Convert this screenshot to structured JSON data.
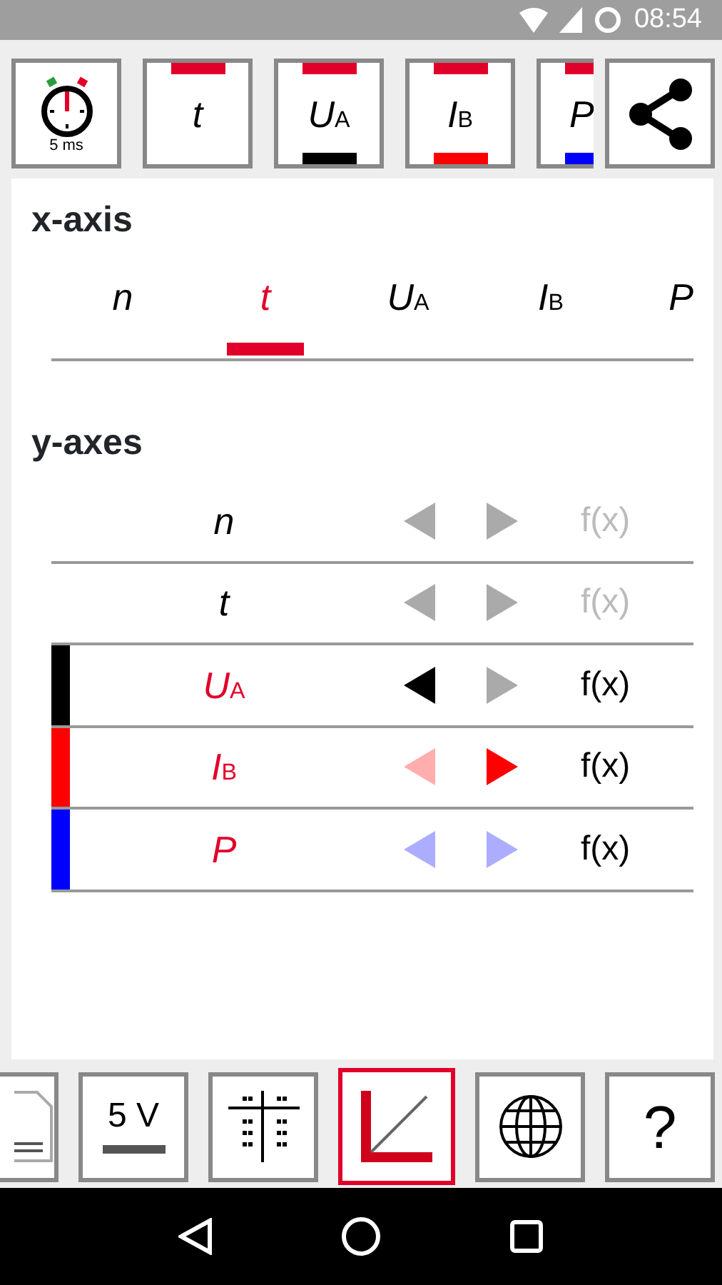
{
  "status_bar": {
    "time": "08:54"
  },
  "top_toolbar": {
    "timer": {
      "label": "5 ms"
    },
    "channels": [
      {
        "symbol": "t",
        "active": true
      },
      {
        "symbol": "U",
        "sub": "A",
        "active": true,
        "color": "#000000"
      },
      {
        "symbol": "I",
        "sub": "B",
        "active": true,
        "color": "#ff0000"
      },
      {
        "symbol": "P",
        "active": true,
        "color": "#0000ff"
      }
    ]
  },
  "x_axis": {
    "title": "x-axis",
    "tabs": [
      {
        "symbol": "n",
        "selected": false
      },
      {
        "symbol": "t",
        "selected": true
      },
      {
        "symbol": "U",
        "sub": "A",
        "selected": false
      },
      {
        "symbol": "I",
        "sub": "B",
        "selected": false
      },
      {
        "symbol": "P",
        "selected": false
      }
    ]
  },
  "y_axes": {
    "title": "y-axes",
    "rows": [
      {
        "symbol": "n",
        "plotted": false,
        "left_on": false,
        "right_on": false,
        "fx": "f(x)",
        "fx_enabled": false
      },
      {
        "symbol": "t",
        "plotted": false,
        "left_on": false,
        "right_on": false,
        "fx": "f(x)",
        "fx_enabled": false
      },
      {
        "symbol": "U",
        "sub": "A",
        "plotted": true,
        "color": "#000000",
        "left_on": true,
        "right_on": false,
        "fx": "f(x)",
        "fx_enabled": true
      },
      {
        "symbol": "I",
        "sub": "B",
        "plotted": true,
        "color": "#ff0000",
        "left_on": false,
        "right_on": true,
        "fx": "f(x)",
        "fx_enabled": true
      },
      {
        "symbol": "P",
        "plotted": true,
        "color": "#0000ff",
        "left_on": false,
        "right_on": false,
        "fx": "f(x)",
        "fx_enabled": true
      }
    ]
  },
  "bottom_toolbar": [
    {
      "kind": "document",
      "selected": false
    },
    {
      "kind": "range",
      "label": "5 V",
      "selected": false
    },
    {
      "kind": "grid",
      "selected": false
    },
    {
      "kind": "axes",
      "selected": true
    },
    {
      "kind": "globe",
      "selected": false
    },
    {
      "kind": "help",
      "label": "?",
      "selected": false
    }
  ]
}
